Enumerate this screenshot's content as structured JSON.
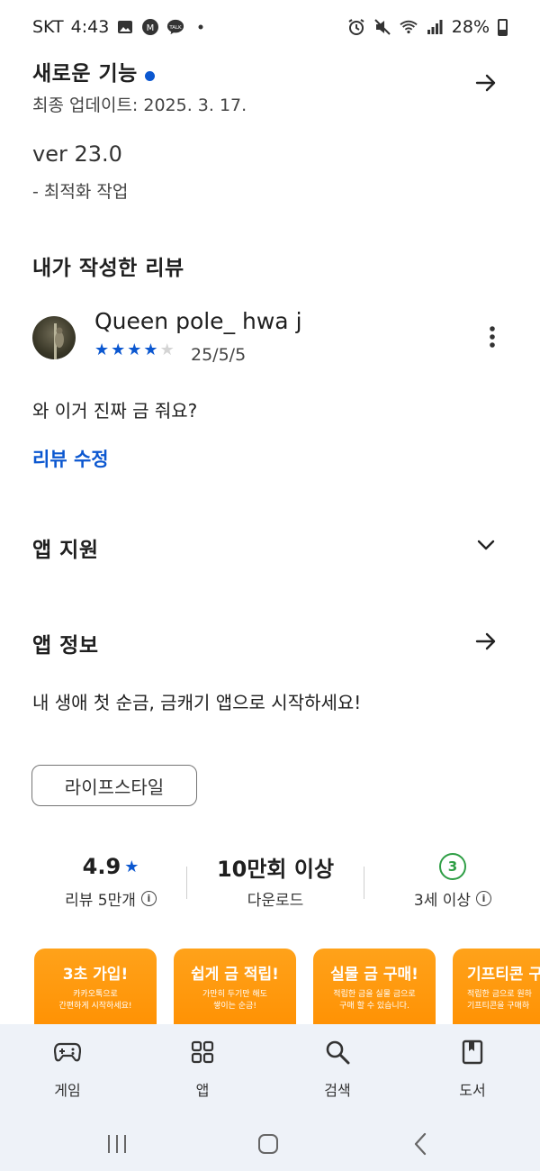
{
  "status_bar": {
    "carrier": "SKT",
    "time": "4:43",
    "battery": "28%"
  },
  "whats_new": {
    "title": "새로운 기능",
    "last_updated": "최종 업데이트: 2025. 3. 17.",
    "version": "ver 23.0",
    "note": "- 최적화 작업"
  },
  "my_review": {
    "section_title": "내가 작성한 리뷰",
    "author": "Queen pole_ hwa j",
    "rating": 4,
    "date": "25/5/5",
    "text": "와 이거 진짜 금 줘요?",
    "edit_label": "리뷰 수정"
  },
  "app_support": {
    "title": "앱 지원"
  },
  "app_info": {
    "title": "앱 정보",
    "description": "내 생애 첫 순금, 금캐기 앱으로 시작하세요!",
    "category_chip": "라이프스타일"
  },
  "stats": {
    "rating_value": "4.9",
    "rating_label": "리뷰 5만개",
    "downloads_value": "10만회 이상",
    "downloads_label": "다운로드",
    "age_badge": "3",
    "age_label": "3세 이상"
  },
  "screenshots": [
    {
      "title": "3초 가입!",
      "desc": "카카오톡으로\n간편하게 시작하세요!"
    },
    {
      "title": "쉽게 금 적립!",
      "desc": "가만히 두기만 해도\n쌓이는 순금!"
    },
    {
      "title": "실물 금 구매!",
      "desc": "적립한 금을 실물 금으로\n구매 할 수 있습니다."
    },
    {
      "title": "기프티콘 구",
      "desc": "적립한 금으로 원하\n기프티콘을 구매하"
    }
  ],
  "bottom_nav": [
    {
      "label": "게임",
      "icon": "gamepad-icon"
    },
    {
      "label": "앱",
      "icon": "apps-grid-icon"
    },
    {
      "label": "검색",
      "icon": "search-icon"
    },
    {
      "label": "도서",
      "icon": "book-icon"
    }
  ],
  "colors": {
    "accent": "#0b57d0",
    "age_green": "#2e9e45",
    "nav_bg": "#eef2f8",
    "shot_orange": "#ff9800"
  }
}
